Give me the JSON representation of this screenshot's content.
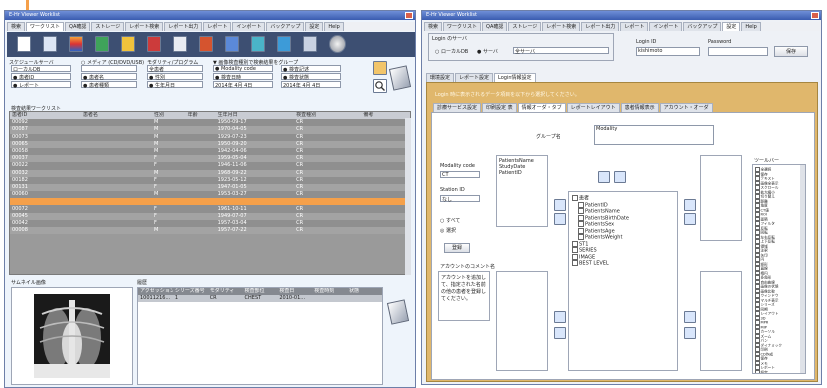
{
  "decor": {
    "orange_accent": "#f5a04a"
  },
  "left_window": {
    "title": "E-Hr Viewer Worklist",
    "menu": [
      "検索",
      "ワークリスト",
      "QA確認",
      "ストレージ",
      "レポート検索",
      "レポート出力",
      "レポート",
      "インポート",
      "バックアップ",
      "設定",
      "Help"
    ],
    "active_tab": "ワークリスト",
    "filter_groups": [
      {
        "header": "スケジュールサーバ",
        "row1": "ローカルDB",
        "row2": "● 患者ID",
        "row3": "● レポート"
      },
      {
        "header": "○ メディア (CD/DVD/USB)",
        "row1": "",
        "row2": "● 患者名",
        "row3": "● 患者種類"
      },
      {
        "header": "モダリティ/プログラム",
        "row1": "全患者",
        "row2": "● 性別",
        "row3": "● 生年月日"
      },
      {
        "header": "▼ 画像検査種別で検索結果をグループ",
        "row1": "● Modality code",
        "row2": "● 検査日時",
        "row3": "2014年 4月 4日"
      },
      {
        "header": "",
        "row1": "● 検査記述",
        "row2": "● 検査状態",
        "row3": "2014年 4月 4日"
      }
    ],
    "list_caption": "検査結果ワークリスト",
    "columns": [
      "患者ID",
      "患者名",
      "性別",
      "年齢",
      "生年月日",
      "検査種別",
      "備考"
    ],
    "rows": [
      [
        "00092",
        "",
        "M",
        "",
        "1950-09-17",
        "CR",
        ""
      ],
      [
        "00087",
        "",
        "M",
        "",
        "1970-04-05",
        "CR",
        ""
      ],
      [
        "00073",
        "",
        "M",
        "",
        "1929-07-23",
        "CR",
        ""
      ],
      [
        "00065",
        "",
        "M",
        "",
        "1950-09-20",
        "CR",
        ""
      ],
      [
        "00058",
        "",
        "M",
        "",
        "1942-04-06",
        "CR",
        ""
      ],
      [
        "00037",
        "",
        "F",
        "",
        "1959-05-04",
        "CR",
        ""
      ],
      [
        "00022",
        "",
        "F",
        "",
        "1946-11-06",
        "CR",
        ""
      ],
      [
        "00032",
        "",
        "M",
        "",
        "1968-09-22",
        "CR",
        ""
      ],
      [
        "00182",
        "",
        "F",
        "",
        "1923-05-12",
        "CR",
        ""
      ],
      [
        "00131",
        "",
        "F",
        "",
        "1947-01-05",
        "CR",
        ""
      ],
      [
        "00060",
        "",
        "M",
        "",
        "1953-03-27",
        "CR",
        ""
      ],
      [
        "",
        "",
        "",
        "",
        "",
        "",
        ""
      ],
      [
        "00072",
        "",
        "F",
        "",
        "1961-10-11",
        "CR",
        ""
      ],
      [
        "00045",
        "",
        "F",
        "",
        "1949-07-07",
        "CR",
        ""
      ],
      [
        "00042",
        "",
        "F",
        "",
        "1957-03-04",
        "CR",
        ""
      ],
      [
        "00008",
        "",
        "M",
        "",
        "1957-07-22",
        "CR",
        ""
      ]
    ],
    "selected_row_index": 11,
    "thumbnail_caption": "サムネイル画像",
    "study_caption": "履歴",
    "study_columns": [
      "アクセッション",
      "シリーズ番号",
      "モダリティ",
      "検査部位",
      "検査日",
      "検査時刻",
      "状態"
    ],
    "study_rows": [
      [
        "10011216...",
        "1",
        "CR",
        "CHEST",
        "2010-01...",
        "",
        ""
      ]
    ]
  },
  "right_window": {
    "title": "E-Hr Viewer Worklist",
    "menu": [
      "検索",
      "ワークリスト",
      "QA確認",
      "ストレージ",
      "レポート検索",
      "レポート出力",
      "レポート",
      "インポート",
      "バックアップ",
      "設定",
      "Help"
    ],
    "active_tab": "設定",
    "login_group": "Login のサーバ",
    "server_option": "○ ローカルDB",
    "server_option2": "● サーバ",
    "server_value": "全サーバ",
    "login_id_label": "Login ID",
    "login_id_value": "kishimoto",
    "password_label": "Password",
    "save_button": "保存",
    "settings_tabs": [
      "環境設定",
      "レポート設定",
      "Login情報設定"
    ],
    "hint_text": "Login 時に表示されるデータ項目を以下から選択してください。",
    "sub_tabs": [
      "診療サービス設定",
      "印刷設定 表",
      "情報オーダ・タブ",
      "レポートレイアウト",
      "患者情報表示",
      "アカウント・オーダ"
    ],
    "group_name_label": "グループ名",
    "group_name_value": "Modality",
    "modality_label": "Modality code",
    "modality_value": "CT",
    "station_label": "Station ID",
    "station_value": "なし",
    "radio_all": "○ すべて",
    "radio_select": "◎ 選択",
    "left_list": [
      "PatientsName",
      "StudyDate",
      "PatientID"
    ],
    "left_button": "登録",
    "tree_items": [
      "患者",
      "PatientID",
      "PatientsName",
      "PatientsBirthDate",
      "PatientsSex",
      "PatientsAge",
      "PatientsWeight",
      "ST1",
      "SERIES",
      "IMAGE",
      "BEST LEVEL"
    ],
    "tool_label": "ツールバー",
    "checkbox_items": [
      "全選択",
      "保存",
      "テキスト",
      "画像全表示",
      "スクロール",
      "拡大縮小",
      "切り替え",
      "距離",
      "角度",
      "CT値",
      "ROI",
      "面積",
      "フィルタ",
      "反転",
      "回転",
      "左右反転",
      "上下反転",
      "領域",
      "注釈",
      "矢印",
      "円",
      "矩形",
      "直線",
      "楕円",
      "多角形",
      "自由曲線",
      "画像の状態",
      "画像比較",
      "ウィンドウ",
      "マルチ表示",
      "シリーズ",
      "同期",
      "レイアウト",
      "3D",
      "MPR",
      "MIP",
      "カーソル",
      "ズーム",
      "パン",
      "ダイナミック",
      "印刷",
      "CD作成",
      "保存",
      "メモ",
      "レポート",
      "設定",
      "ヘルプ",
      "キー画像",
      "ヒストグラム",
      "終了"
    ],
    "display_label": "アカウントのコメント名",
    "display_note": "アカウントを追加して、指定された名前の他の患者を登録してください。"
  }
}
